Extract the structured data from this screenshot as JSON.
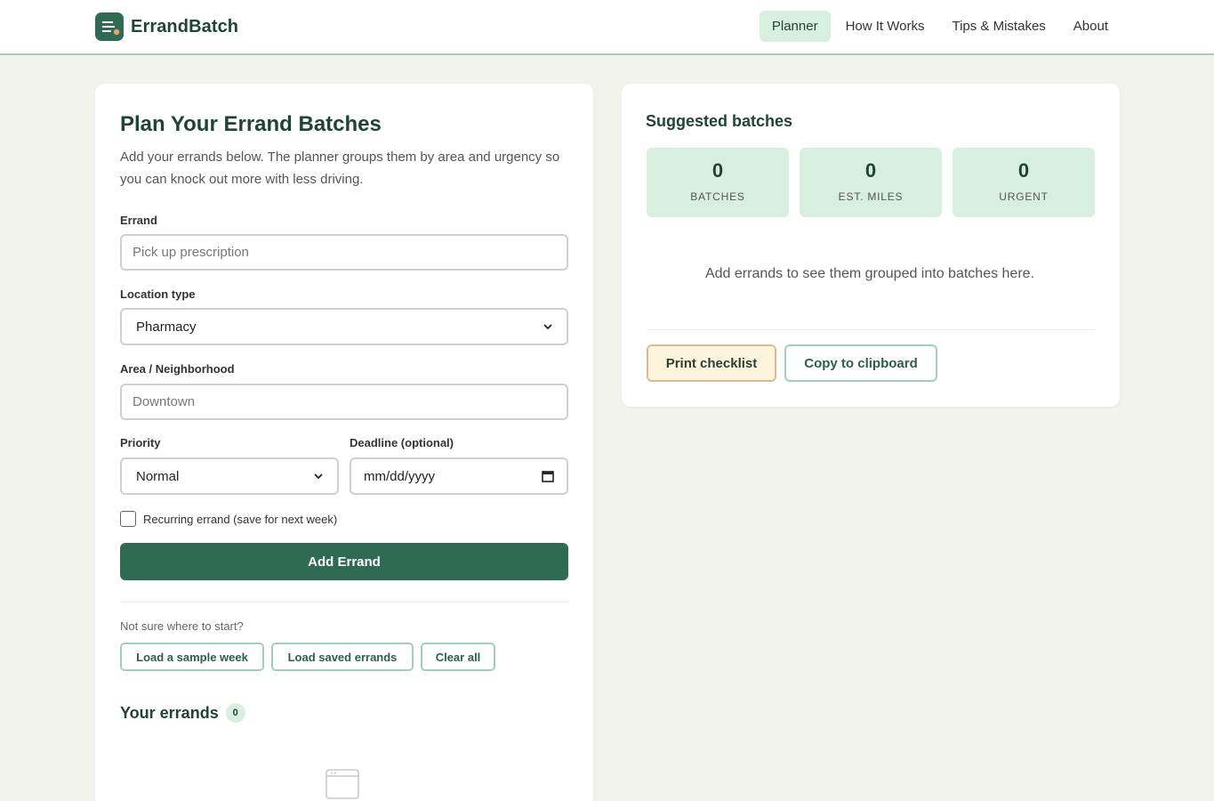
{
  "header": {
    "brand": "ErrandBatch",
    "nav": [
      {
        "label": "Planner",
        "active": true
      },
      {
        "label": "How It Works",
        "active": false
      },
      {
        "label": "Tips & Mistakes",
        "active": false
      },
      {
        "label": "About",
        "active": false
      }
    ]
  },
  "form": {
    "title": "Plan Your Errand Batches",
    "intro": "Add your errands below. The planner groups them by area and urgency so you can knock out more with less driving.",
    "errand_label": "Errand",
    "errand_placeholder": "Pick up prescription",
    "location_label": "Location type",
    "location_value": "Pharmacy",
    "area_label": "Area / Neighborhood",
    "area_placeholder": "Downtown",
    "priority_label": "Priority",
    "priority_value": "Normal",
    "deadline_label": "Deadline (optional)",
    "deadline_value": "mm/dd/yyyy",
    "recurring_label": "Recurring errand (save for next week)",
    "recurring_checked": false,
    "add_button": "Add Errand",
    "hint": "Not sure where to start?",
    "load_sample": "Load a sample week",
    "load_saved": "Load saved errands",
    "clear_all": "Clear all",
    "list_title": "Your errands",
    "list_count": "0"
  },
  "summary": {
    "title": "Suggested batches",
    "stats": [
      {
        "value": "0",
        "label": "BATCHES"
      },
      {
        "value": "0",
        "label": "EST. MILES"
      },
      {
        "value": "0",
        "label": "URGENT"
      }
    ],
    "empty_message": "Add errands to see them grouped into batches here.",
    "print_button": "Print checklist",
    "copy_button": "Copy to clipboard"
  },
  "colors": {
    "brand": "#2e6b52",
    "accent_light": "#d8efdf",
    "page_bg": "#f3f3ee",
    "print_bg": "#fdf4dd"
  }
}
